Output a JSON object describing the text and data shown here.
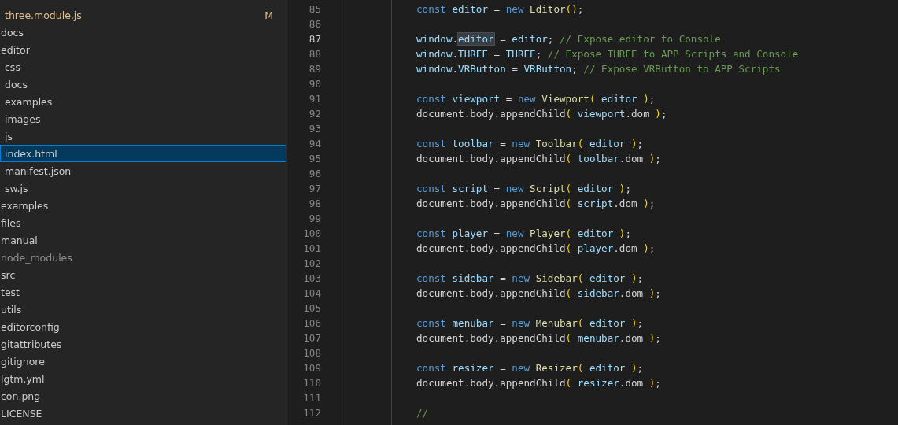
{
  "explorer": {
    "unseen_parent_children": [
      {
        "name": "three.module.js",
        "modified": true,
        "ignored": false,
        "badge": "M",
        "selected": false
      }
    ],
    "items": [
      {
        "name": "docs",
        "modified": false,
        "ignored": false,
        "selected": false
      },
      {
        "name": "editor",
        "modified": false,
        "ignored": false,
        "selected": false,
        "children": [
          {
            "name": "css",
            "modified": false,
            "ignored": false,
            "selected": false
          },
          {
            "name": "docs",
            "modified": false,
            "ignored": false,
            "selected": false
          },
          {
            "name": "examples",
            "modified": false,
            "ignored": false,
            "selected": false
          },
          {
            "name": "images",
            "modified": false,
            "ignored": false,
            "selected": false
          },
          {
            "name": "js",
            "modified": false,
            "ignored": false,
            "selected": false
          },
          {
            "name": "index.html",
            "modified": false,
            "ignored": false,
            "selected": true
          },
          {
            "name": "manifest.json",
            "modified": false,
            "ignored": false,
            "selected": false
          },
          {
            "name": "sw.js",
            "modified": false,
            "ignored": false,
            "selected": false
          }
        ]
      },
      {
        "name": "examples",
        "modified": false,
        "ignored": false,
        "selected": false
      },
      {
        "name": "files",
        "modified": false,
        "ignored": false,
        "selected": false
      },
      {
        "name": "manual",
        "modified": false,
        "ignored": false,
        "selected": false
      },
      {
        "name": "node_modules",
        "modified": false,
        "ignored": true,
        "selected": false
      },
      {
        "name": "src",
        "modified": false,
        "ignored": false,
        "selected": false
      },
      {
        "name": "test",
        "modified": false,
        "ignored": false,
        "selected": false
      },
      {
        "name": "utils",
        "modified": false,
        "ignored": false,
        "selected": false
      },
      {
        "name": "editorconfig",
        "modified": false,
        "ignored": false,
        "selected": false
      },
      {
        "name": "gitattributes",
        "modified": false,
        "ignored": false,
        "selected": false
      },
      {
        "name": "gitignore",
        "modified": false,
        "ignored": false,
        "selected": false
      },
      {
        "name": "lgtm.yml",
        "modified": false,
        "ignored": false,
        "selected": false
      },
      {
        "name": "con.png",
        "modified": false,
        "ignored": false,
        "selected": false
      },
      {
        "name": "LICENSE",
        "modified": false,
        "ignored": false,
        "selected": false
      }
    ]
  },
  "editor": {
    "lines": [
      {
        "number": "85",
        "current": false,
        "tokens": [
          {
            "kind": "keyword",
            "text": "const "
          },
          {
            "kind": "var",
            "text": "editor"
          },
          {
            "kind": "plain",
            "text": " = "
          },
          {
            "kind": "keyword",
            "text": "new "
          },
          {
            "kind": "type",
            "text": "Editor"
          },
          {
            "kind": "paren",
            "text": "()"
          },
          {
            "kind": "plain",
            "text": ";"
          }
        ]
      },
      {
        "number": "86",
        "current": false
      },
      {
        "number": "87",
        "current": true,
        "tokens": [
          {
            "kind": "var",
            "text": "window"
          },
          {
            "kind": "plain",
            "text": "."
          },
          {
            "kind": "selected",
            "text": "editor"
          },
          {
            "kind": "plain",
            "text": " = "
          },
          {
            "kind": "var",
            "text": "editor"
          },
          {
            "kind": "plain",
            "text": "; "
          },
          {
            "kind": "comment",
            "text": "// Expose editor to Console"
          }
        ]
      },
      {
        "number": "88",
        "current": false,
        "tokens": [
          {
            "kind": "var",
            "text": "window"
          },
          {
            "kind": "plain",
            "text": "."
          },
          {
            "kind": "var",
            "text": "THREE"
          },
          {
            "kind": "plain",
            "text": " = "
          },
          {
            "kind": "var",
            "text": "THREE"
          },
          {
            "kind": "plain",
            "text": "; "
          },
          {
            "kind": "comment",
            "text": "// Expose THREE to APP Scripts and Console"
          }
        ]
      },
      {
        "number": "89",
        "current": false,
        "tokens": [
          {
            "kind": "var",
            "text": "window"
          },
          {
            "kind": "plain",
            "text": "."
          },
          {
            "kind": "var",
            "text": "VRButton"
          },
          {
            "kind": "plain",
            "text": " = "
          },
          {
            "kind": "var",
            "text": "VRButton"
          },
          {
            "kind": "plain",
            "text": "; "
          },
          {
            "kind": "comment",
            "text": "// Expose VRButton to APP Scripts"
          }
        ]
      },
      {
        "number": "90",
        "current": false
      },
      {
        "number": "91",
        "current": false,
        "tokens": [
          {
            "kind": "keyword",
            "text": "const "
          },
          {
            "kind": "var",
            "text": "viewport"
          },
          {
            "kind": "plain",
            "text": " = "
          },
          {
            "kind": "keyword",
            "text": "new "
          },
          {
            "kind": "type",
            "text": "Viewport"
          },
          {
            "kind": "paren",
            "text": "( "
          },
          {
            "kind": "var",
            "text": "editor"
          },
          {
            "kind": "paren",
            "text": " )"
          },
          {
            "kind": "plain",
            "text": ";"
          }
        ]
      },
      {
        "number": "92",
        "current": false,
        "tokens": [
          {
            "kind": "plain",
            "text": "document.body.appendChild"
          },
          {
            "kind": "paren",
            "text": "( "
          },
          {
            "kind": "var",
            "text": "viewport"
          },
          {
            "kind": "plain",
            "text": ".dom"
          },
          {
            "kind": "paren",
            "text": " )"
          },
          {
            "kind": "plain",
            "text": ";"
          }
        ]
      },
      {
        "number": "93",
        "current": false
      },
      {
        "number": "94",
        "current": false,
        "tokens": [
          {
            "kind": "keyword",
            "text": "const "
          },
          {
            "kind": "var",
            "text": "toolbar"
          },
          {
            "kind": "plain",
            "text": " = "
          },
          {
            "kind": "keyword",
            "text": "new "
          },
          {
            "kind": "type",
            "text": "Toolbar"
          },
          {
            "kind": "paren",
            "text": "( "
          },
          {
            "kind": "var",
            "text": "editor"
          },
          {
            "kind": "paren",
            "text": " )"
          },
          {
            "kind": "plain",
            "text": ";"
          }
        ]
      },
      {
        "number": "95",
        "current": false,
        "tokens": [
          {
            "kind": "plain",
            "text": "document.body.appendChild"
          },
          {
            "kind": "paren",
            "text": "( "
          },
          {
            "kind": "var",
            "text": "toolbar"
          },
          {
            "kind": "plain",
            "text": ".dom"
          },
          {
            "kind": "paren",
            "text": " )"
          },
          {
            "kind": "plain",
            "text": ";"
          }
        ]
      },
      {
        "number": "96",
        "current": false
      },
      {
        "number": "97",
        "current": false,
        "tokens": [
          {
            "kind": "keyword",
            "text": "const "
          },
          {
            "kind": "var",
            "text": "script"
          },
          {
            "kind": "plain",
            "text": " = "
          },
          {
            "kind": "keyword",
            "text": "new "
          },
          {
            "kind": "type",
            "text": "Script"
          },
          {
            "kind": "paren",
            "text": "( "
          },
          {
            "kind": "var",
            "text": "editor"
          },
          {
            "kind": "paren",
            "text": " )"
          },
          {
            "kind": "plain",
            "text": ";"
          }
        ]
      },
      {
        "number": "98",
        "current": false,
        "tokens": [
          {
            "kind": "plain",
            "text": "document.body.appendChild"
          },
          {
            "kind": "paren",
            "text": "( "
          },
          {
            "kind": "var",
            "text": "script"
          },
          {
            "kind": "plain",
            "text": ".dom"
          },
          {
            "kind": "paren",
            "text": " )"
          },
          {
            "kind": "plain",
            "text": ";"
          }
        ]
      },
      {
        "number": "99",
        "current": false
      },
      {
        "number": "100",
        "current": false,
        "tokens": [
          {
            "kind": "keyword",
            "text": "const "
          },
          {
            "kind": "var",
            "text": "player"
          },
          {
            "kind": "plain",
            "text": " = "
          },
          {
            "kind": "keyword",
            "text": "new "
          },
          {
            "kind": "type",
            "text": "Player"
          },
          {
            "kind": "paren",
            "text": "( "
          },
          {
            "kind": "var",
            "text": "editor"
          },
          {
            "kind": "paren",
            "text": " )"
          },
          {
            "kind": "plain",
            "text": ";"
          }
        ]
      },
      {
        "number": "101",
        "current": false,
        "tokens": [
          {
            "kind": "plain",
            "text": "document.body.appendChild"
          },
          {
            "kind": "paren",
            "text": "( "
          },
          {
            "kind": "var",
            "text": "player"
          },
          {
            "kind": "plain",
            "text": ".dom"
          },
          {
            "kind": "paren",
            "text": " )"
          },
          {
            "kind": "plain",
            "text": ";"
          }
        ]
      },
      {
        "number": "102",
        "current": false
      },
      {
        "number": "103",
        "current": false,
        "tokens": [
          {
            "kind": "keyword",
            "text": "const "
          },
          {
            "kind": "var",
            "text": "sidebar"
          },
          {
            "kind": "plain",
            "text": " = "
          },
          {
            "kind": "keyword",
            "text": "new "
          },
          {
            "kind": "type",
            "text": "Sidebar"
          },
          {
            "kind": "paren",
            "text": "( "
          },
          {
            "kind": "var",
            "text": "editor"
          },
          {
            "kind": "paren",
            "text": " )"
          },
          {
            "kind": "plain",
            "text": ";"
          }
        ]
      },
      {
        "number": "104",
        "current": false,
        "tokens": [
          {
            "kind": "plain",
            "text": "document.body.appendChild"
          },
          {
            "kind": "paren",
            "text": "( "
          },
          {
            "kind": "var",
            "text": "sidebar"
          },
          {
            "kind": "plain",
            "text": ".dom"
          },
          {
            "kind": "paren",
            "text": " )"
          },
          {
            "kind": "plain",
            "text": ";"
          }
        ]
      },
      {
        "number": "105",
        "current": false
      },
      {
        "number": "106",
        "current": false,
        "tokens": [
          {
            "kind": "keyword",
            "text": "const "
          },
          {
            "kind": "var",
            "text": "menubar"
          },
          {
            "kind": "plain",
            "text": " = "
          },
          {
            "kind": "keyword",
            "text": "new "
          },
          {
            "kind": "type",
            "text": "Menubar"
          },
          {
            "kind": "paren",
            "text": "( "
          },
          {
            "kind": "var",
            "text": "editor"
          },
          {
            "kind": "paren",
            "text": " )"
          },
          {
            "kind": "plain",
            "text": ";"
          }
        ]
      },
      {
        "number": "107",
        "current": false,
        "tokens": [
          {
            "kind": "plain",
            "text": "document.body.appendChild"
          },
          {
            "kind": "paren",
            "text": "( "
          },
          {
            "kind": "var",
            "text": "menubar"
          },
          {
            "kind": "plain",
            "text": ".dom"
          },
          {
            "kind": "paren",
            "text": " )"
          },
          {
            "kind": "plain",
            "text": ";"
          }
        ]
      },
      {
        "number": "108",
        "current": false
      },
      {
        "number": "109",
        "current": false,
        "tokens": [
          {
            "kind": "keyword",
            "text": "const "
          },
          {
            "kind": "var",
            "text": "resizer"
          },
          {
            "kind": "plain",
            "text": " = "
          },
          {
            "kind": "keyword",
            "text": "new "
          },
          {
            "kind": "type",
            "text": "Resizer"
          },
          {
            "kind": "paren",
            "text": "( "
          },
          {
            "kind": "var",
            "text": "editor"
          },
          {
            "kind": "paren",
            "text": " )"
          },
          {
            "kind": "plain",
            "text": ";"
          }
        ]
      },
      {
        "number": "110",
        "current": false,
        "tokens": [
          {
            "kind": "plain",
            "text": "document.body.appendChild"
          },
          {
            "kind": "paren",
            "text": "( "
          },
          {
            "kind": "var",
            "text": "resizer"
          },
          {
            "kind": "plain",
            "text": ".dom"
          },
          {
            "kind": "paren",
            "text": " )"
          },
          {
            "kind": "plain",
            "text": ";"
          }
        ]
      },
      {
        "number": "111",
        "current": false
      },
      {
        "number": "112",
        "current": false,
        "tokens": [
          {
            "kind": "comment",
            "text": "//"
          }
        ]
      }
    ]
  }
}
